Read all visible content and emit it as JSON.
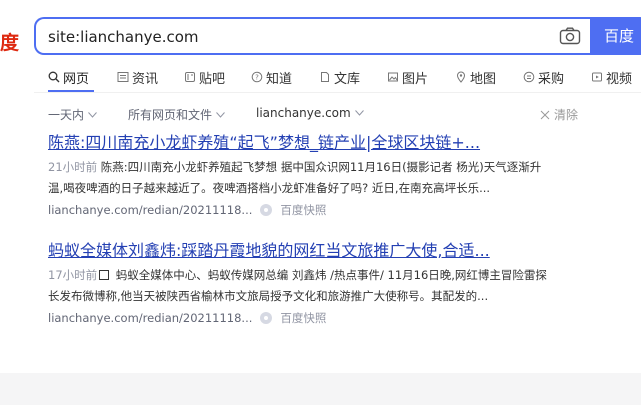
{
  "logo": {
    "text": "度"
  },
  "search": {
    "query": "site:lianchanye.com",
    "button_label": "百度"
  },
  "tabs": [
    {
      "label": "网页",
      "icon": "search-icon",
      "active": true
    },
    {
      "label": "资讯",
      "icon": "news-icon"
    },
    {
      "label": "贴吧",
      "icon": "tieba-icon"
    },
    {
      "label": "知道",
      "icon": "question-icon"
    },
    {
      "label": "文库",
      "icon": "document-icon"
    },
    {
      "label": "图片",
      "icon": "image-icon"
    },
    {
      "label": "地图",
      "icon": "map-pin-icon"
    },
    {
      "label": "采购",
      "icon": "shopping-icon"
    },
    {
      "label": "视频",
      "icon": "video-icon"
    }
  ],
  "filters": {
    "time": "一天内",
    "scope": "所有网页和文件",
    "site": "lianchanye.com",
    "clear": "清除"
  },
  "results": [
    {
      "title": "陈燕:四川南充小龙虾养殖“起飞”梦想_链产业|全球区块链+...",
      "time": "21小时前",
      "snippet_line1": " 陈燕:四川南充小龙虾养殖起飞梦想 据中国众识网11月16日(摄影记者 杨光)天气逐渐升",
      "snippet_line2": "温,喝夜啤酒的日子越来越近了。夜啤酒搭档小龙虾准备好了吗? 近日,在南充高坪长乐...",
      "url": "lianchanye.com/redian/20211118...",
      "cache": "百度快照"
    },
    {
      "title": "蚂蚁全媒体刘鑫炜:踩踏丹霞地貌的网红当文旅推广大使,合适...",
      "time": "17小时前",
      "snippet_line1": " 蚂蚁全媒体中心、蚂蚁传媒网总编 刘鑫炜 /热点事件/ 11月16日晚,网红博主冒险雷探",
      "snippet_line2": "长发布微博称,他当天被陕西省榆林市文旅局授予文化和旅游推广大使称号。其配发的...",
      "url": "lianchanye.com/redian/20211118...",
      "cache": "百度快照"
    }
  ],
  "colors": {
    "accent": "#4e6ef2",
    "link": "#2440b3",
    "logo": "#de2910"
  }
}
